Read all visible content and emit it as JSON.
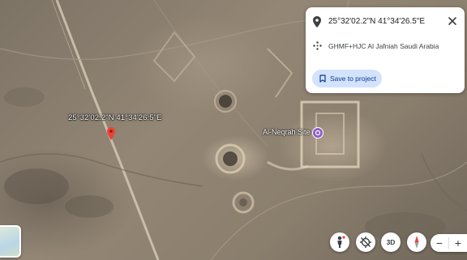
{
  "map": {
    "pin_coordinates_label": "25°32'02.2\"N 41°34'26.5\"E",
    "site_label": "Al-Neqrah Site"
  },
  "info_panel": {
    "coordinates": "25°32'02.2\"N 41°34'26.5\"E",
    "plus_code": "GHMF+HJC Al Jafniah Saudi Arabia",
    "save_button_label": "Save to project"
  },
  "controls": {
    "three_d_label": "3D",
    "zoom_out_label": "−",
    "zoom_in_label": "+"
  },
  "colors": {
    "pin_red": "#ea4335",
    "site_icon_purple": "#8e5fc8",
    "save_button_bg": "#d3e3fd",
    "save_button_text": "#0b3a8a"
  },
  "icons": {
    "coordinates_row": "location-pin-icon",
    "plus_code_row": "plus-code-icon",
    "save_button": "bookmark-icon",
    "close": "close-icon"
  }
}
